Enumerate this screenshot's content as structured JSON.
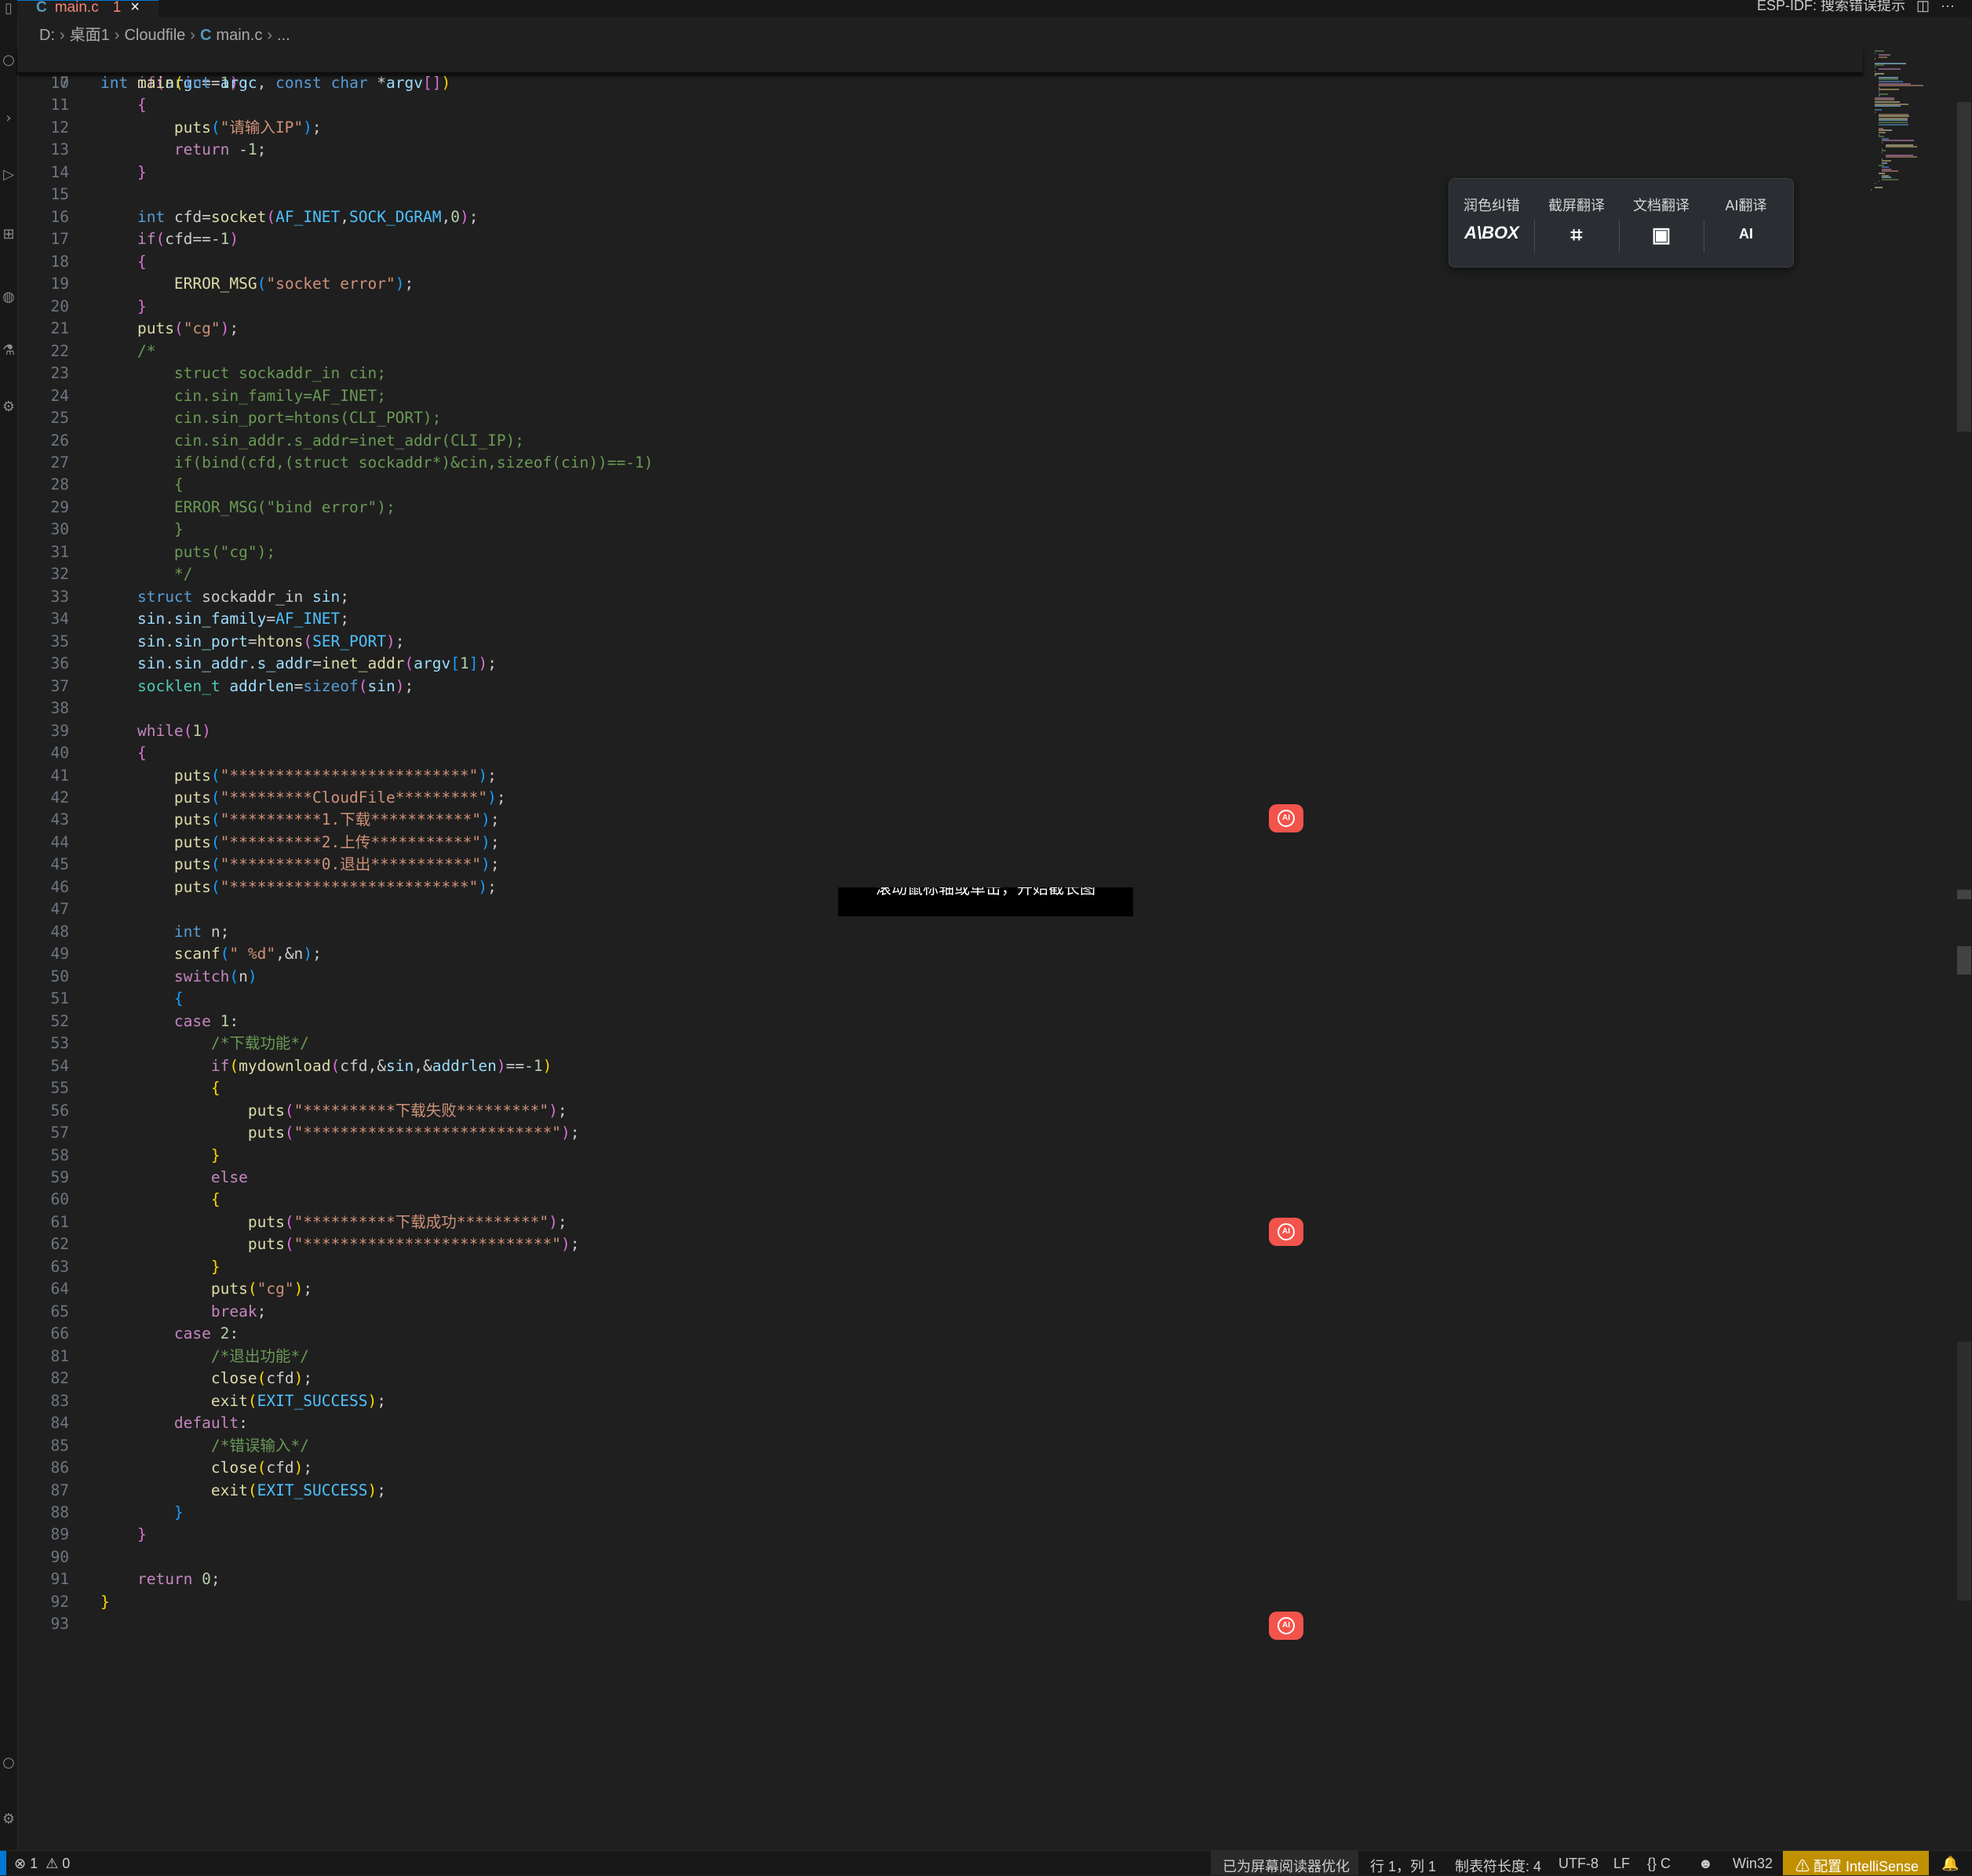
{
  "tab": {
    "icon": "C",
    "file": "main.c",
    "problems": "1",
    "close": "×"
  },
  "topbar": {
    "text": "ESP-IDF: 搜索错误提示",
    "split": "◫",
    "more": "···"
  },
  "breadcrumb": {
    "drive": "D:",
    "folder1": "桌面1",
    "folder2": "Cloudfile",
    "file_icon": "C",
    "file": "main.c",
    "more": "..."
  },
  "sticky": {
    "number": "7",
    "text": "int main(int argc, const char *argv[])"
  },
  "code_lines": [
    {
      "n": "10",
      "t": "    if(argc==1)"
    },
    {
      "n": "11",
      "t": "    {"
    },
    {
      "n": "12",
      "t": "        puts(\"请输入IP\");"
    },
    {
      "n": "13",
      "t": "        return -1;"
    },
    {
      "n": "14",
      "t": "    }"
    },
    {
      "n": "15",
      "t": ""
    },
    {
      "n": "16",
      "t": "    int cfd=socket(AF_INET,SOCK_DGRAM,0);"
    },
    {
      "n": "17",
      "t": "    if(cfd==-1)"
    },
    {
      "n": "18",
      "t": "    {"
    },
    {
      "n": "19",
      "t": "        ERROR_MSG(\"socket error\");"
    },
    {
      "n": "20",
      "t": "    }"
    },
    {
      "n": "21",
      "t": "    puts(\"cg\");"
    },
    {
      "n": "22",
      "t": "    /*"
    },
    {
      "n": "23",
      "t": "        struct sockaddr_in cin;"
    },
    {
      "n": "24",
      "t": "        cin.sin_family=AF_INET;"
    },
    {
      "n": "25",
      "t": "        cin.sin_port=htons(CLI_PORT);"
    },
    {
      "n": "26",
      "t": "        cin.sin_addr.s_addr=inet_addr(CLI_IP);"
    },
    {
      "n": "27",
      "t": "        if(bind(cfd,(struct sockaddr*)&cin,sizeof(cin))==-1)"
    },
    {
      "n": "28",
      "t": "        {"
    },
    {
      "n": "29",
      "t": "        ERROR_MSG(\"bind error\");"
    },
    {
      "n": "30",
      "t": "        }"
    },
    {
      "n": "31",
      "t": "        puts(\"cg\");"
    },
    {
      "n": "32",
      "t": "        */"
    },
    {
      "n": "33",
      "t": "    struct sockaddr_in sin;"
    },
    {
      "n": "34",
      "t": "    sin.sin_family=AF_INET;"
    },
    {
      "n": "35",
      "t": "    sin.sin_port=htons(SER_PORT);"
    },
    {
      "n": "36",
      "t": "    sin.sin_addr.s_addr=inet_addr(argv[1]);"
    },
    {
      "n": "37",
      "t": "    socklen_t addrlen=sizeof(sin);"
    },
    {
      "n": "38",
      "t": ""
    },
    {
      "n": "39",
      "t": "    while(1)"
    },
    {
      "n": "40",
      "t": "    {"
    },
    {
      "n": "41",
      "t": "        puts(\"**************************\");"
    },
    {
      "n": "42",
      "t": "        puts(\"*********CloudFile*********\");"
    },
    {
      "n": "43",
      "t": "        puts(\"**********1.下载***********\");"
    },
    {
      "n": "44",
      "t": "        puts(\"**********2.上传***********\");"
    },
    {
      "n": "45",
      "t": "        puts(\"**********0.退出***********\");"
    },
    {
      "n": "46",
      "t": "        puts(\"**************************\");"
    },
    {
      "n": "47",
      "t": ""
    },
    {
      "n": "48",
      "t": "        int n;"
    },
    {
      "n": "49",
      "t": "        scanf(\" %d\",&n);"
    },
    {
      "n": "50",
      "t": "        switch(n)"
    },
    {
      "n": "51",
      "t": "        {"
    },
    {
      "n": "52",
      "t": "        case 1:"
    },
    {
      "n": "53",
      "t": "            /*下载功能*/"
    },
    {
      "n": "54",
      "t": "            if(mydownload(cfd,&sin,&addrlen)==-1)"
    },
    {
      "n": "55",
      "t": "            {"
    },
    {
      "n": "56",
      "t": "                puts(\"**********下载失败*********\");"
    },
    {
      "n": "57",
      "t": "                puts(\"***************************\");"
    },
    {
      "n": "58",
      "t": "            }"
    },
    {
      "n": "59",
      "t": "            else"
    },
    {
      "n": "60",
      "t": "            {"
    },
    {
      "n": "61",
      "t": "                puts(\"**********下载成功*********\");"
    },
    {
      "n": "62",
      "t": "                puts(\"***************************\");"
    },
    {
      "n": "63",
      "t": "            }"
    },
    {
      "n": "64",
      "t": "            puts(\"cg\");"
    },
    {
      "n": "65",
      "t": "            break;"
    },
    {
      "n": "66",
      "t": "        case 2:"
    },
    {
      "n": "81",
      "t": "            /*退出功能*/"
    },
    {
      "n": "82",
      "t": "            close(cfd);"
    },
    {
      "n": "83",
      "t": "            exit(EXIT_SUCCESS);"
    },
    {
      "n": "84",
      "t": "        default:"
    },
    {
      "n": "85",
      "t": "            /*错误输入*/"
    },
    {
      "n": "86",
      "t": "            close(cfd);"
    },
    {
      "n": "87",
      "t": "            exit(EXIT_SUCCESS);"
    },
    {
      "n": "88",
      "t": "        }"
    },
    {
      "n": "89",
      "t": "    }"
    },
    {
      "n": "90",
      "t": ""
    },
    {
      "n": "91",
      "t": "    return 0;"
    },
    {
      "n": "92",
      "t": "}"
    },
    {
      "n": "93",
      "t": ""
    }
  ],
  "translate_toolbar": {
    "items": [
      {
        "label": "润色纠错",
        "icon": "A\\BOX"
      },
      {
        "label": "截屏翻译",
        "icon": "⌗"
      },
      {
        "label": "文档翻译",
        "icon": "▣"
      },
      {
        "label": "AI翻译",
        "icon": "AI"
      }
    ]
  },
  "ai_badge_text": "AI",
  "tooltip": "滚动鼠标轴或单击，开始截长图",
  "status": {
    "errors": "⊗ 1",
    "warnings": "⚠ 0",
    "screen_reader": "已为屏幕阅读器优化",
    "position": "行 1，列 1",
    "tab_size": "制表符长度: 4",
    "encoding": "UTF-8",
    "eol": "LF",
    "language": "{} C",
    "copilot_icon": "☻",
    "platform": "Win32",
    "intellisense": "⚠ 配置 IntelliSense",
    "bell": "🔔"
  },
  "colors": {
    "accent": "#0078d4",
    "editor_bg": "#1f1f1f",
    "badge": "#f2544b",
    "warning_bg": "#c09000"
  }
}
